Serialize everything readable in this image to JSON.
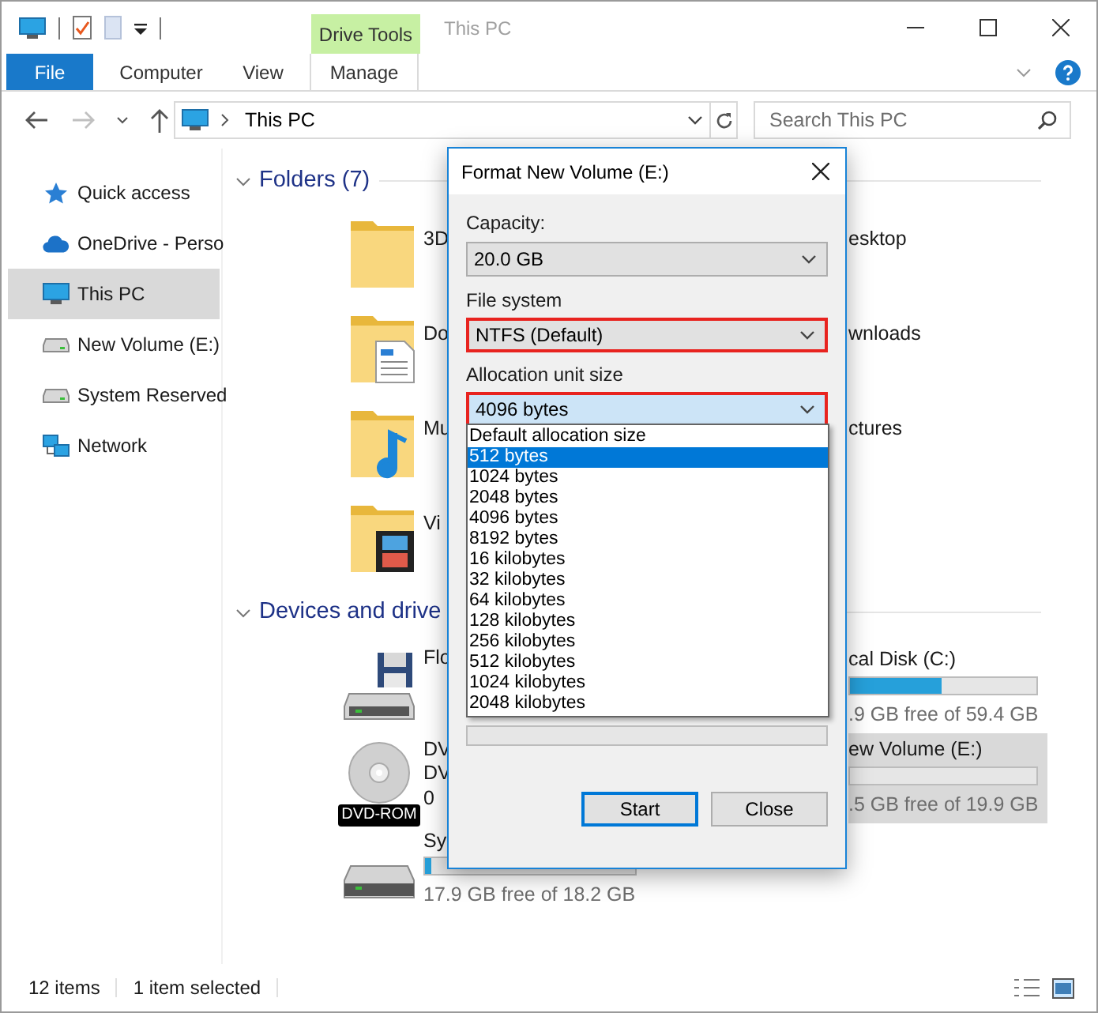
{
  "title_bar": {
    "title": "This PC",
    "context_group": "Drive Tools"
  },
  "ribbon_tabs": [
    {
      "label": "File",
      "kind": "file"
    },
    {
      "label": "Computer",
      "kind": "tab"
    },
    {
      "label": "View",
      "kind": "tab"
    },
    {
      "label": "Manage",
      "kind": "context"
    }
  ],
  "address_bar": {
    "path": "This PC"
  },
  "search": {
    "placeholder": "Search This PC"
  },
  "navigation": [
    {
      "label": "Quick access",
      "kind": "star",
      "selected": false
    },
    {
      "label": "OneDrive - Perso",
      "kind": "cloud",
      "selected": false
    },
    {
      "label": "This PC",
      "kind": "pc",
      "selected": true
    },
    {
      "label": "New Volume (E:)",
      "kind": "drive",
      "selected": false
    },
    {
      "label": "System Reserved",
      "kind": "drive",
      "selected": false
    },
    {
      "label": "Network",
      "kind": "network",
      "selected": false
    }
  ],
  "folders": {
    "title": "Folders (7)",
    "expanded": true,
    "rows": [
      {
        "left": {
          "name": "3D",
          "kind": "cube"
        },
        "right": {
          "name": "esktop"
        }
      },
      {
        "left": {
          "name": "Do",
          "kind": "documents"
        },
        "right": {
          "name": "wnloads"
        }
      },
      {
        "left": {
          "name": "Mu",
          "kind": "music"
        },
        "right": {
          "name": "ctures"
        }
      },
      {
        "left": {
          "name": "Vi",
          "kind": "videos"
        }
      }
    ]
  },
  "drives": {
    "title": "Devices and drive",
    "expanded": true,
    "left": [
      {
        "kind": "floppy",
        "lines": [
          "Flo"
        ]
      },
      {
        "kind": "dvd",
        "badge": "DVD-ROM",
        "lines": [
          "DV",
          "DV",
          "0"
        ]
      },
      {
        "kind": "disk",
        "lines": [
          "Sy"
        ],
        "level": 0.03,
        "free": "17.9 GB free of 18.2 GB"
      }
    ],
    "right": [
      {
        "name": "cal Disk (C:)",
        "level": 0.49,
        "free": ".9 GB free of 59.4 GB",
        "selected": false
      },
      {
        "name": "ew Volume (E:)",
        "level": 0,
        "free": ".5 GB free of 19.9 GB",
        "selected": true
      }
    ]
  },
  "status_bar": {
    "item_count": "12 items",
    "selection": "1 item selected"
  },
  "dialog": {
    "title": "Format New Volume (E:)",
    "fields": [
      {
        "label": "Capacity:",
        "value": "20.0 GB",
        "highlighted": false,
        "focused": false
      },
      {
        "label": "File system",
        "value": "NTFS (Default)",
        "highlighted": true,
        "focused": false
      },
      {
        "label": "Allocation unit size",
        "value": "4096 bytes",
        "highlighted": true,
        "focused": true
      }
    ],
    "dropdown_options": [
      {
        "label": "Default allocation size",
        "selected": false
      },
      {
        "label": "512 bytes",
        "selected": true
      },
      {
        "label": "1024 bytes",
        "selected": false
      },
      {
        "label": "2048 bytes",
        "selected": false
      },
      {
        "label": "4096 bytes",
        "selected": false
      },
      {
        "label": "8192 bytes",
        "selected": false
      },
      {
        "label": "16 kilobytes",
        "selected": false
      },
      {
        "label": "32 kilobytes",
        "selected": false
      },
      {
        "label": "64 kilobytes",
        "selected": false
      },
      {
        "label": "128 kilobytes",
        "selected": false
      },
      {
        "label": "256 kilobytes",
        "selected": false
      },
      {
        "label": "512 kilobytes",
        "selected": false
      },
      {
        "label": "1024 kilobytes",
        "selected": false
      },
      {
        "label": "2048 kilobytes",
        "selected": false
      }
    ],
    "progress": {
      "level": 0
    },
    "buttons": [
      {
        "label": "Start",
        "default": true
      },
      {
        "label": "Close",
        "default": false
      }
    ]
  }
}
